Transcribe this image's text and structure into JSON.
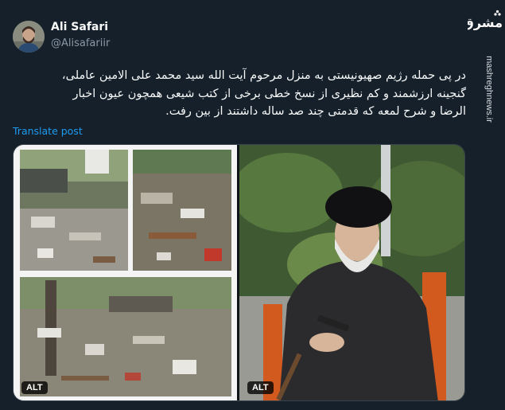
{
  "author": {
    "name": "Ali Safari",
    "handle": "@Alisafariir"
  },
  "post": {
    "lines": [
      "در پی حمله رژیم صهیونیستی به منزل مرحوم آیت الله سید محمد علی الامین عاملی،",
      "گنجینه ارزشمند و کم نظیری از نسخ خطی برخی از کتب شیعی همچون عیون اخبار",
      "الرضا و شرح لمعه که قدمتی چند صد ساله داشتند از بین رفت."
    ],
    "translate_label": "Translate post"
  },
  "media": {
    "left_alt": "ALT",
    "right_alt": "ALT"
  },
  "brand": {
    "logo_text": "مشرق",
    "url": "mashreghnews.ir"
  },
  "colors": {
    "background": "#15202b",
    "link": "#1d9bf0",
    "muted": "#8b98a5"
  }
}
